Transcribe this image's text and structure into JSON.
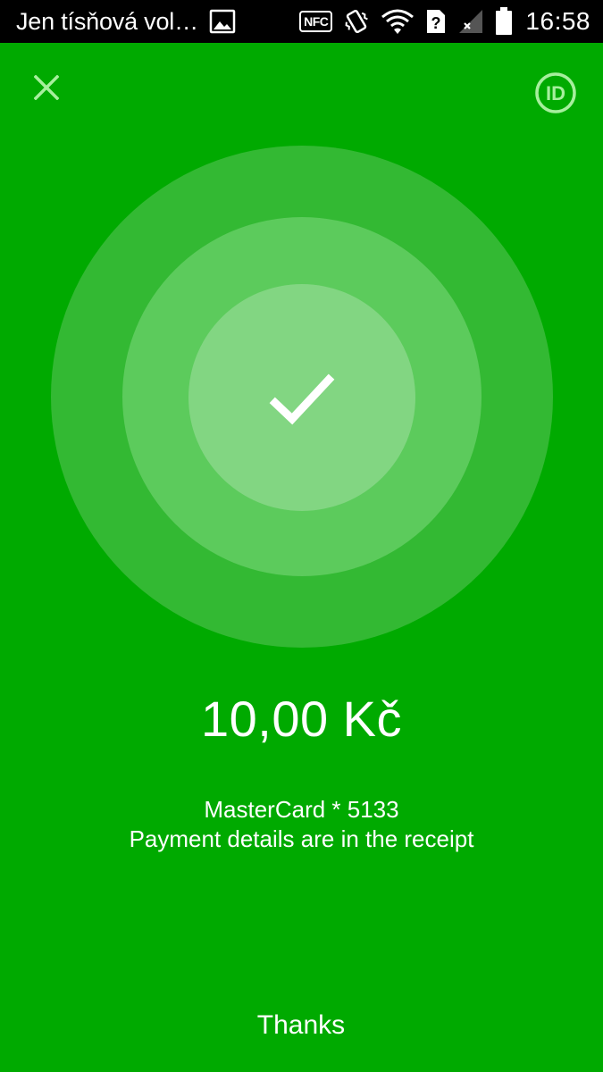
{
  "status_bar": {
    "notification_text": "Jen tísňová vol…",
    "nfc_label": "NFC",
    "time": "16:58",
    "icons": [
      "image-notification-icon",
      "nfc-icon",
      "vibrate-icon",
      "wifi-icon",
      "unknown-sim-icon",
      "signal-icon",
      "battery-icon"
    ]
  },
  "header": {
    "close_icon": "close-icon",
    "id_label": "ID"
  },
  "payment": {
    "status_icon": "checkmark-icon",
    "amount": "10,00 Kč",
    "card": "MasterCard * 5133",
    "details_note": "Payment details are in the receipt"
  },
  "footer": {
    "thanks_label": "Thanks"
  },
  "colors": {
    "background": "#00aa00",
    "ring_outer": "#33b933",
    "ring_middle": "#5ccb5c",
    "ring_inner": "#82d682",
    "icon_light": "#a6ef9d",
    "text": "#ffffff"
  }
}
